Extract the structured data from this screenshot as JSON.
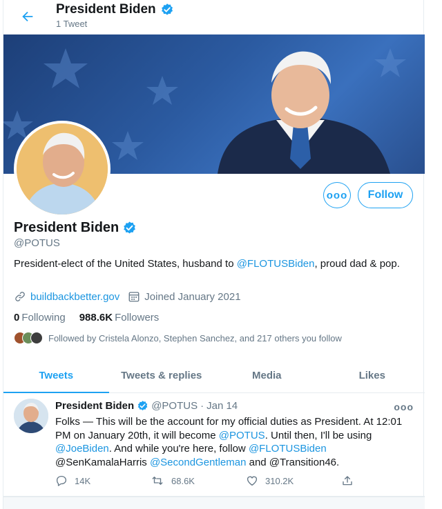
{
  "header": {
    "name": "President Biden",
    "tweet_count": "1 Tweet"
  },
  "actions": {
    "more_label": "ooo",
    "follow_label": "Follow"
  },
  "profile": {
    "name": "President Biden",
    "handle": "@POTUS",
    "bio_pre": "President-elect of the United States, husband to ",
    "bio_mention": "@FLOTUSBiden",
    "bio_post": ", proud dad & pop.",
    "website": "buildbackbetter.gov",
    "joined": "Joined January 2021",
    "following_count": "0",
    "following_label": "Following",
    "followers_count": "988.6K",
    "followers_label": "Followers",
    "followed_by": "Followed by Cristela Alonzo, Stephen Sanchez, and 217 others you follow"
  },
  "tabs": [
    {
      "label": "Tweets"
    },
    {
      "label": "Tweets & replies"
    },
    {
      "label": "Media"
    },
    {
      "label": "Likes"
    }
  ],
  "tweet": {
    "name": "President Biden",
    "handle": "@POTUS",
    "sep": "·",
    "date": "Jan 14",
    "more": "ooo",
    "text": {
      "p1": "Folks — This will be the account for my official duties as President. At 12:01 PM on January 20th, it will become ",
      "m1": "@POTUS",
      "p2": ". Until then, I'll be using ",
      "m2": "@JoeBiden",
      "p3": ". And while you're here, follow ",
      "m3": "@FLOTUSBiden",
      "p4": " @SenKamalaHarris ",
      "m4": "@SecondGentleman",
      "p5": " and @Transition46."
    },
    "replies": "14K",
    "retweets": "68.6K",
    "likes": "310.2K"
  },
  "colors": {
    "accent": "#1da1f2",
    "link": "#1b95e0",
    "secondary_text": "#657786"
  }
}
